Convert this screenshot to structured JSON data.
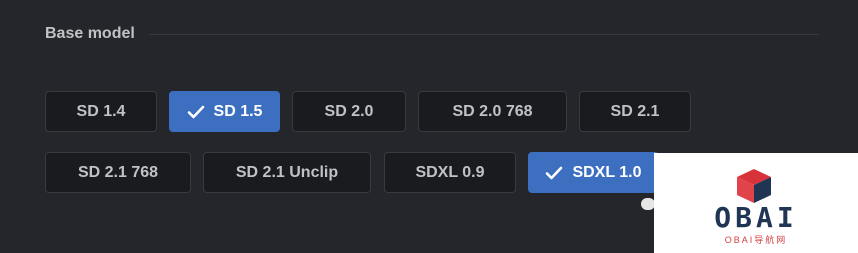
{
  "section": {
    "title": "Base model"
  },
  "chips": [
    {
      "label": "SD 1.4",
      "checked": false
    },
    {
      "label": "SD 1.5",
      "checked": true
    },
    {
      "label": "SD 2.0",
      "checked": false
    },
    {
      "label": "SD 2.0 768",
      "checked": false
    },
    {
      "label": "SD 2.1",
      "checked": false
    },
    {
      "label": "SD 2.1 768",
      "checked": false
    },
    {
      "label": "SD 2.1 Unclip",
      "checked": false
    },
    {
      "label": "SDXL 0.9",
      "checked": false
    },
    {
      "label": "SDXL 1.0",
      "checked": true
    }
  ],
  "icons": {
    "check": "check-icon"
  },
  "colors": {
    "background": "#25262b",
    "chip_background": "#1a1b1e",
    "chip_border": "#373a40",
    "checked_background": "#3d6fc0",
    "text": "#c1c2c5"
  },
  "watermark": {
    "logo_text": "OBAI",
    "subtext": "OBAI导航网"
  }
}
